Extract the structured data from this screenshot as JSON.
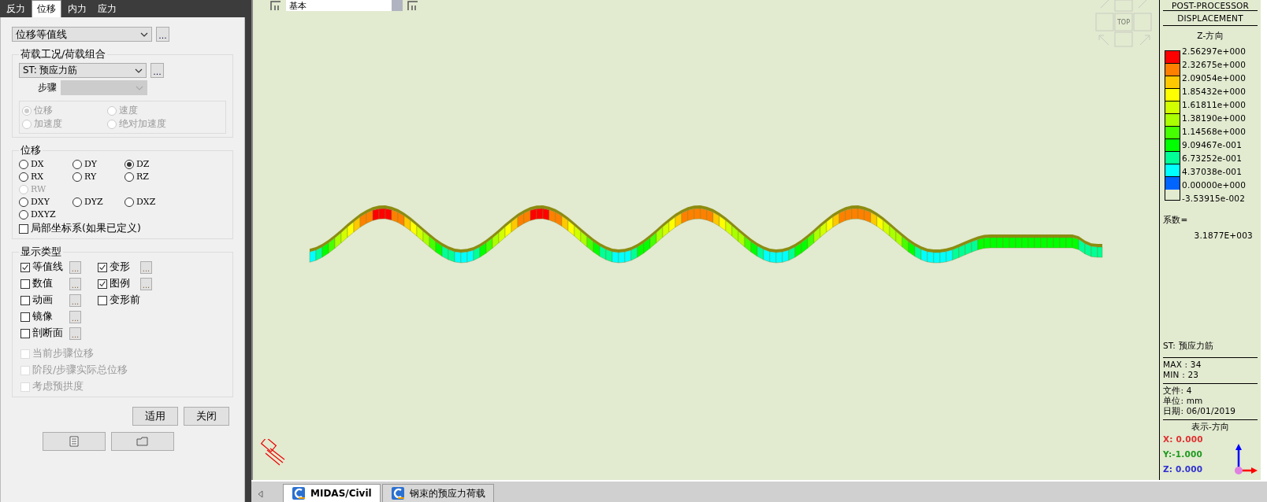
{
  "panel_tabs": [
    {
      "label": "反力",
      "selected": false
    },
    {
      "label": "位移",
      "selected": true
    },
    {
      "label": "内力",
      "selected": false
    },
    {
      "label": "应力",
      "selected": false
    }
  ],
  "result_type": {
    "value": "位移等值线",
    "button": "..."
  },
  "load_case": {
    "title": "荷载工况/荷载组合",
    "value": "ST: 预应力筋",
    "button": "...",
    "step_label": "步骤",
    "response_options": [
      {
        "label": "位移",
        "selected": true,
        "disabled": true
      },
      {
        "label": "速度",
        "selected": false,
        "disabled": true
      },
      {
        "label": "加速度",
        "selected": false,
        "disabled": true
      },
      {
        "label": "绝对加速度",
        "selected": false,
        "disabled": true
      }
    ]
  },
  "displacement": {
    "title": "位移",
    "options": [
      {
        "label": "DX",
        "selected": false,
        "disabled": false
      },
      {
        "label": "DY",
        "selected": false,
        "disabled": false
      },
      {
        "label": "DZ",
        "selected": true,
        "disabled": false
      },
      {
        "label": "RX",
        "selected": false,
        "disabled": false
      },
      {
        "label": "RY",
        "selected": false,
        "disabled": false
      },
      {
        "label": "RZ",
        "selected": false,
        "disabled": false
      },
      {
        "label": "RW",
        "selected": false,
        "disabled": true
      },
      {
        "label": "DXY",
        "selected": false,
        "disabled": false
      },
      {
        "label": "DYZ",
        "selected": false,
        "disabled": false
      },
      {
        "label": "DXZ",
        "selected": false,
        "disabled": false
      },
      {
        "label": "DXYZ",
        "selected": false,
        "disabled": false
      }
    ],
    "local_coord": {
      "label": "局部坐标系(如果已定义)",
      "checked": false
    }
  },
  "display_types": {
    "title": "显示类型",
    "items": [
      {
        "label": "等值线",
        "checked": true,
        "button": "..."
      },
      {
        "label": "变形",
        "checked": true,
        "button": "..."
      },
      {
        "label": "数值",
        "checked": false,
        "button": "..."
      },
      {
        "label": "图例",
        "checked": true,
        "button": "..."
      },
      {
        "label": "动画",
        "checked": false,
        "button": "..."
      },
      {
        "label": "变形前",
        "checked": false
      },
      {
        "label": "镜像",
        "checked": false,
        "button": "..."
      },
      {
        "label": "剖断面",
        "checked": false,
        "button": "..."
      }
    ],
    "extra_items": [
      {
        "label": "当前步骤位移",
        "checked": false,
        "disabled": true
      },
      {
        "label": "阶段/步骤实际总位移",
        "checked": false,
        "disabled": true
      },
      {
        "label": "考虑预拱度",
        "checked": false,
        "disabled": true
      }
    ]
  },
  "buttons": [
    "适用",
    "关闭"
  ],
  "toolbar": {
    "combo": "基本"
  },
  "view_cube": {
    "label": "TOP"
  },
  "legend": {
    "header": "POST-PROCESSOR",
    "subtitle": "DISPLACEMENT",
    "direction": "Z-方向",
    "bands": [
      {
        "color": "#ff0000",
        "label": "2.56297e+000"
      },
      {
        "color": "#ff8000",
        "label": "2.32675e+000"
      },
      {
        "color": "#ffc800",
        "label": "2.09054e+000"
      },
      {
        "color": "#ffff00",
        "label": "1.85432e+000"
      },
      {
        "color": "#d2ff00",
        "label": "1.61811e+000"
      },
      {
        "color": "#aaff00",
        "label": "1.38190e+000"
      },
      {
        "color": "#46ff00",
        "label": "1.14568e+000"
      },
      {
        "color": "#00ff00",
        "label": "9.09467e-001"
      },
      {
        "color": "#00ff96",
        "label": "6.73252e-001"
      },
      {
        "color": "#00ffff",
        "label": "4.37038e-001"
      },
      {
        "color": "#0064ff",
        "label": "0.00000e+000"
      }
    ],
    "bottom_label": "-3.53915e-002",
    "factor_label": "系数=",
    "factor_value": "3.1877E+003",
    "load_case": "ST: 预应力筋",
    "max": "MAX : 34",
    "min": "MIN : 23",
    "file": "文件: 4",
    "unit": "单位: mm",
    "date": "日期: 06/01/2019",
    "view_dir_title": "表示-方向",
    "coords": [
      {
        "text": "X: 0.000",
        "color": "#e03030"
      },
      {
        "text": "Y:-1.000",
        "color": "#1f9a1f"
      },
      {
        "text": "Z: 0.000",
        "color": "#3030d0"
      }
    ]
  },
  "doc_tabs": [
    {
      "label": "MIDAS/Civil",
      "selected": true
    },
    {
      "label": "钢束的预应力荷载",
      "selected": false
    }
  ]
}
